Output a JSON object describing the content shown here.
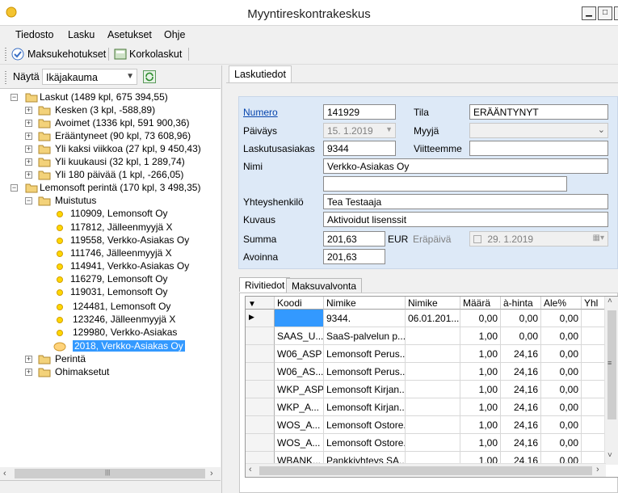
{
  "window": {
    "title": "Myyntireskontrakeskus"
  },
  "menu": [
    "Tiedosto",
    "Lasku",
    "Asetukset",
    "Ohje"
  ],
  "toolbar": {
    "payments": "Maksukehotukset",
    "interest": "Korkolaskut"
  },
  "left": {
    "show_label": "Näytä",
    "show_value": "Ikäjakauma",
    "tree": [
      {
        "label": "Laskut (1489 kpl, 675 394,55)"
      },
      {
        "label": "Kesken (3 kpl, -588,89)"
      },
      {
        "label": "Avoimet (1336 kpl, 591 900,36)"
      },
      {
        "label": "Erääntyneet (90 kpl, 73 608,96)"
      },
      {
        "label": "Yli kaksi viikkoa (27 kpl, 9 450,43)"
      },
      {
        "label": "Yli kuukausi (32 kpl, 1 289,74)"
      },
      {
        "label": "Yli 180 päivää (1 kpl, -266,05)"
      },
      {
        "label": "Lemonsoft perintä (170 kpl, 3 498,35)"
      },
      {
        "label": "Muistutus"
      },
      {
        "label": "110909, Lemonsoft Oy"
      },
      {
        "label": "117812, Jälleenmyyjä X"
      },
      {
        "label": "119558, Verkko-Asiakas Oy"
      },
      {
        "label": "111746, Jälleenmyyjä X"
      },
      {
        "label": "114941, Verkko-Asiakas Oy"
      },
      {
        "label": "116279, Lemonsoft Oy"
      },
      {
        "label": "119031, Lemonsoft Oy"
      },
      {
        "label": "124481, Lemonsoft Oy"
      },
      {
        "label": "123246, Jälleenmyyjä X"
      },
      {
        "label": "129980, Verkko-Asiakas"
      },
      {
        "label": "2018, Verkko-Asiakas Oy"
      },
      {
        "label": "Perintä"
      },
      {
        "label": "Ohimaksetut"
      }
    ]
  },
  "tabs": {
    "main": "Laskutiedot",
    "rows": "Rivitiedot",
    "monitor": "Maksuvalvonta"
  },
  "form": {
    "number_label": "Numero",
    "number": "141929",
    "status_label": "Tila",
    "status": "ERÄÄNTYNYT",
    "date_label": "Päiväys",
    "date": "15. 1.2019",
    "seller_label": "Myyjä",
    "seller": "",
    "customer_label": "Laskutusasiakas",
    "customer": "9344",
    "ref_label": "Viitteemme",
    "ref": "",
    "name_label": "Nimi",
    "name": "Verkko-Asiakas Oy",
    "name2": "",
    "contact_label": "Yhteyshenkilö",
    "contact": "Tea Testaaja",
    "desc_label": "Kuvaus",
    "desc": "Aktivoidut lisenssit",
    "sum_label": "Summa",
    "sum": "201,63",
    "currency": "EUR",
    "due_label": "Eräpäivä",
    "due": "29. 1.2019",
    "open_label": "Avoinna",
    "open": "201,63"
  },
  "grid": {
    "columns": [
      "Koodi",
      "Nimike",
      "Nimike",
      "Määrä",
      "à-hinta",
      "Ale%",
      "Yhl"
    ],
    "rows": [
      [
        "",
        "9344.",
        "06.01.201...",
        "0,00",
        "0,00",
        "0,00"
      ],
      [
        "SAAS_U...",
        "SaaS-palvelun p...",
        "",
        "1,00",
        "0,00",
        "0,00"
      ],
      [
        "W06_ASP",
        "Lemonsoft Perus...",
        "",
        "1,00",
        "24,16",
        "0,00"
      ],
      [
        "W06_AS...",
        "Lemonsoft Perus...",
        "",
        "1,00",
        "24,16",
        "0,00"
      ],
      [
        "WKP_ASP",
        "Lemonsoft Kirjan...",
        "",
        "1,00",
        "24,16",
        "0,00"
      ],
      [
        "WKP_A...",
        "Lemonsoft Kirjan...",
        "",
        "1,00",
        "24,16",
        "0,00"
      ],
      [
        "WOS_A...",
        "Lemonsoft Ostore...",
        "",
        "1,00",
        "24,16",
        "0,00"
      ],
      [
        "WOS_A...",
        "Lemonsoft Ostore...",
        "",
        "1,00",
        "24,16",
        "0,00"
      ],
      [
        "WBANK...",
        "Pankkiyhteys SA...",
        "",
        "1,00",
        "24,16",
        "0,00"
      ]
    ]
  },
  "colors": {
    "accent": "#3399ff",
    "form_bg": "#dde9f7",
    "link": "#0645ad"
  }
}
